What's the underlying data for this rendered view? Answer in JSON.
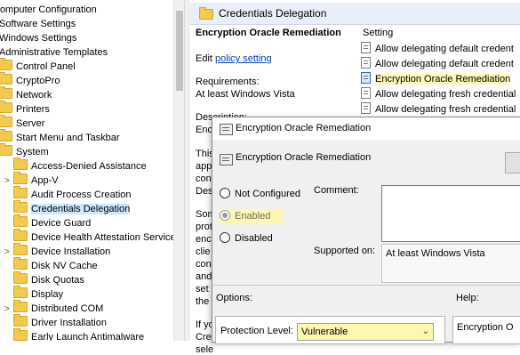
{
  "tree": {
    "items": [
      {
        "label": "Computer Configuration",
        "icon": "none"
      },
      {
        "label": "Software Settings",
        "icon": "none"
      },
      {
        "label": "Windows Settings",
        "icon": "none"
      },
      {
        "label": "Administrative Templates",
        "icon": "none"
      },
      {
        "label": "Control Panel",
        "icon": "folder-icon"
      },
      {
        "label": "CryptoPro",
        "icon": "folder-icon"
      },
      {
        "label": "Network",
        "icon": "folder-icon"
      },
      {
        "label": "Printers",
        "icon": "folder-icon"
      },
      {
        "label": "Server",
        "icon": "folder-icon"
      },
      {
        "label": "Start Menu and Taskbar",
        "icon": "folder-icon"
      },
      {
        "label": "System",
        "icon": "folder-icon"
      },
      {
        "label": "Access-Denied Assistance",
        "icon": "folder-icon"
      },
      {
        "label": "App-V",
        "icon": "folder-icon",
        "expander": ">"
      },
      {
        "label": "Audit Process Creation",
        "icon": "folder-icon"
      },
      {
        "label": "Credentials Delegation",
        "icon": "folder-icon",
        "selected": true
      },
      {
        "label": "Device Guard",
        "icon": "folder-icon"
      },
      {
        "label": "Device Health Attestation Service",
        "icon": "folder-icon"
      },
      {
        "label": "Device Installation",
        "icon": "folder-icon",
        "expander": ">"
      },
      {
        "label": "Disk NV Cache",
        "icon": "folder-icon"
      },
      {
        "label": "Disk Quotas",
        "icon": "folder-icon"
      },
      {
        "label": "Display",
        "icon": "folder-icon"
      },
      {
        "label": "Distributed COM",
        "icon": "folder-icon",
        "expander": ">"
      },
      {
        "label": "Driver Installation",
        "icon": "folder-icon"
      },
      {
        "label": "Early Launch Antimalware",
        "icon": "folder-icon"
      }
    ]
  },
  "pane": {
    "header_title": "Credentials Delegation",
    "desc": {
      "title": "Encryption Oracle Remediation",
      "edit_prefix": "Edit",
      "edit_link": "policy setting",
      "req_label": "Requirements:",
      "req_value": "At least Windows Vista",
      "description_label": "Description:",
      "fragments": [
        "Enc",
        "This",
        "app",
        "con",
        "Des",
        "Som",
        "prot",
        "enc",
        "clie",
        "con",
        "and",
        "set t",
        "the",
        "If yo",
        "Cre",
        "sele"
      ]
    },
    "setting_header": "Setting",
    "settings": [
      {
        "label": "Allow delegating default credent"
      },
      {
        "label": "Allow delegating default credent"
      },
      {
        "label": "Encryption Oracle Remediation",
        "highlighted": true
      },
      {
        "label": "Allow delegating fresh credential"
      },
      {
        "label": "Allow delegating fresh credential"
      }
    ]
  },
  "dialog": {
    "window_title": "Encryption Oracle Remediation",
    "subtitle": "Encryption Oracle Remediation",
    "radio_not_configured": "Not Configured",
    "radio_enabled": "Enabled",
    "radio_disabled": "Disabled",
    "selected": "Enabled",
    "comment_label": "Comment:",
    "comment_value": "",
    "supported_label": "Supported on:",
    "supported_value": "At least Windows Vista",
    "options_label": "Options:",
    "help_label": "Help:",
    "protection_label": "Protection Level:",
    "protection_value": "Vulnerable",
    "help_text": "Encryption O"
  },
  "colors": {
    "highlight": "#fdf7b0",
    "selection": "#cce8ff",
    "link": "#0645ad"
  }
}
